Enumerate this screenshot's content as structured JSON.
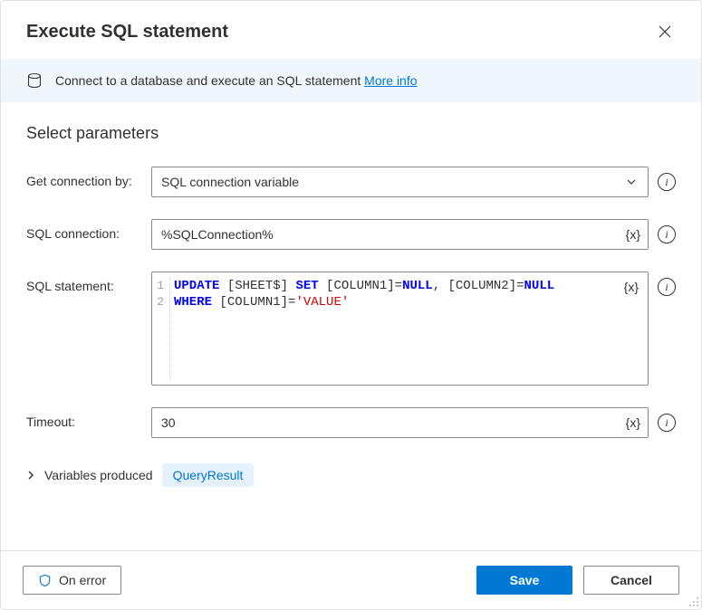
{
  "header": {
    "title": "Execute SQL statement"
  },
  "banner": {
    "text": "Connect to a database and execute an SQL statement ",
    "link_text": "More info"
  },
  "section_heading": "Select parameters",
  "fields": {
    "get_connection_by": {
      "label": "Get connection by:",
      "value": "SQL connection variable"
    },
    "sql_connection": {
      "label": "SQL connection:",
      "value": "%SQLConnection%"
    },
    "sql_statement": {
      "label": "SQL statement:",
      "lines": [
        "1",
        "2"
      ],
      "code_line_1_tokens": [
        {
          "t": "UPDATE",
          "c": "kw"
        },
        {
          "t": " [SHEET$] ",
          "c": ""
        },
        {
          "t": "SET",
          "c": "kw"
        },
        {
          "t": " [COLUMN1]=",
          "c": ""
        },
        {
          "t": "NULL",
          "c": "nul"
        },
        {
          "t": ", [COLUMN2]=",
          "c": ""
        },
        {
          "t": "NULL",
          "c": "nul"
        }
      ],
      "code_line_2_tokens": [
        {
          "t": "WHERE",
          "c": "kw"
        },
        {
          "t": " [COLUMN1]=",
          "c": ""
        },
        {
          "t": "'VALUE'",
          "c": "str"
        }
      ]
    },
    "timeout": {
      "label": "Timeout:",
      "value": "30"
    }
  },
  "var_badge": "{x}",
  "variables_produced": {
    "label": "Variables produced",
    "chip": "QueryResult"
  },
  "footer": {
    "on_error": "On error",
    "save": "Save",
    "cancel": "Cancel"
  }
}
